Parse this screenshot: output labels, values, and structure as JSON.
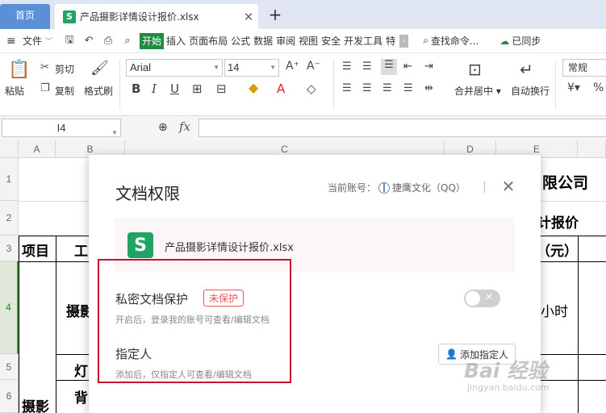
{
  "tabs": {
    "home": "首页",
    "file": "产品摄影详情设计报价.xlsx"
  },
  "menu": {
    "file": "文件",
    "tabs": [
      "开始",
      "插入",
      "页面布局",
      "公式",
      "数据",
      "审阅",
      "视图",
      "安全",
      "开发工具",
      "特"
    ],
    "active_tab": "开始",
    "search": "查找命令...",
    "sync": "已同步"
  },
  "ribbon": {
    "paste": "粘贴",
    "cut": "剪切",
    "copy": "复制",
    "format_painter": "格式刷",
    "font_name": "Arial",
    "font_size": "14",
    "merge": "合并居中",
    "wrap": "自动换行",
    "number_format": "常规"
  },
  "formula_bar": {
    "cell_ref": "I4",
    "fx": "fx"
  },
  "columns": [
    "A",
    "B",
    "C",
    "D",
    "E"
  ],
  "rows": [
    "1",
    "2",
    "3",
    "4",
    "5",
    "6"
  ],
  "cells": {
    "r1": "限公司",
    "r2": "计报价",
    "r3_a": "项目",
    "r3_b": "工",
    "r3_e": "（元）",
    "r4_b": "摄影",
    "r4_e": "小时",
    "r5_b": "灯",
    "r6_a": "摄影",
    "r6_b": "背"
  },
  "dialog": {
    "title": "文档权限",
    "account_label": "当前账号：",
    "account_name": "捷鹰文化（QQ）",
    "file_name": "产品摄影详情设计报价.xlsx",
    "private_title": "私密文档保护",
    "private_badge": "未保护",
    "private_desc": "开启后，登录我的账号可查看/编辑文档",
    "assignee_title": "指定人",
    "assignee_desc": "添加后，仅指定人可查看/编辑文档",
    "add_button": "添加指定人"
  },
  "watermark": {
    "big": "Bai 经验",
    "small": "jingyan.baidu.com"
  },
  "colors": {
    "accent_green": "#1e8e3e",
    "annotation_red": "#c8102e",
    "badge_red": "#e65a5a"
  }
}
